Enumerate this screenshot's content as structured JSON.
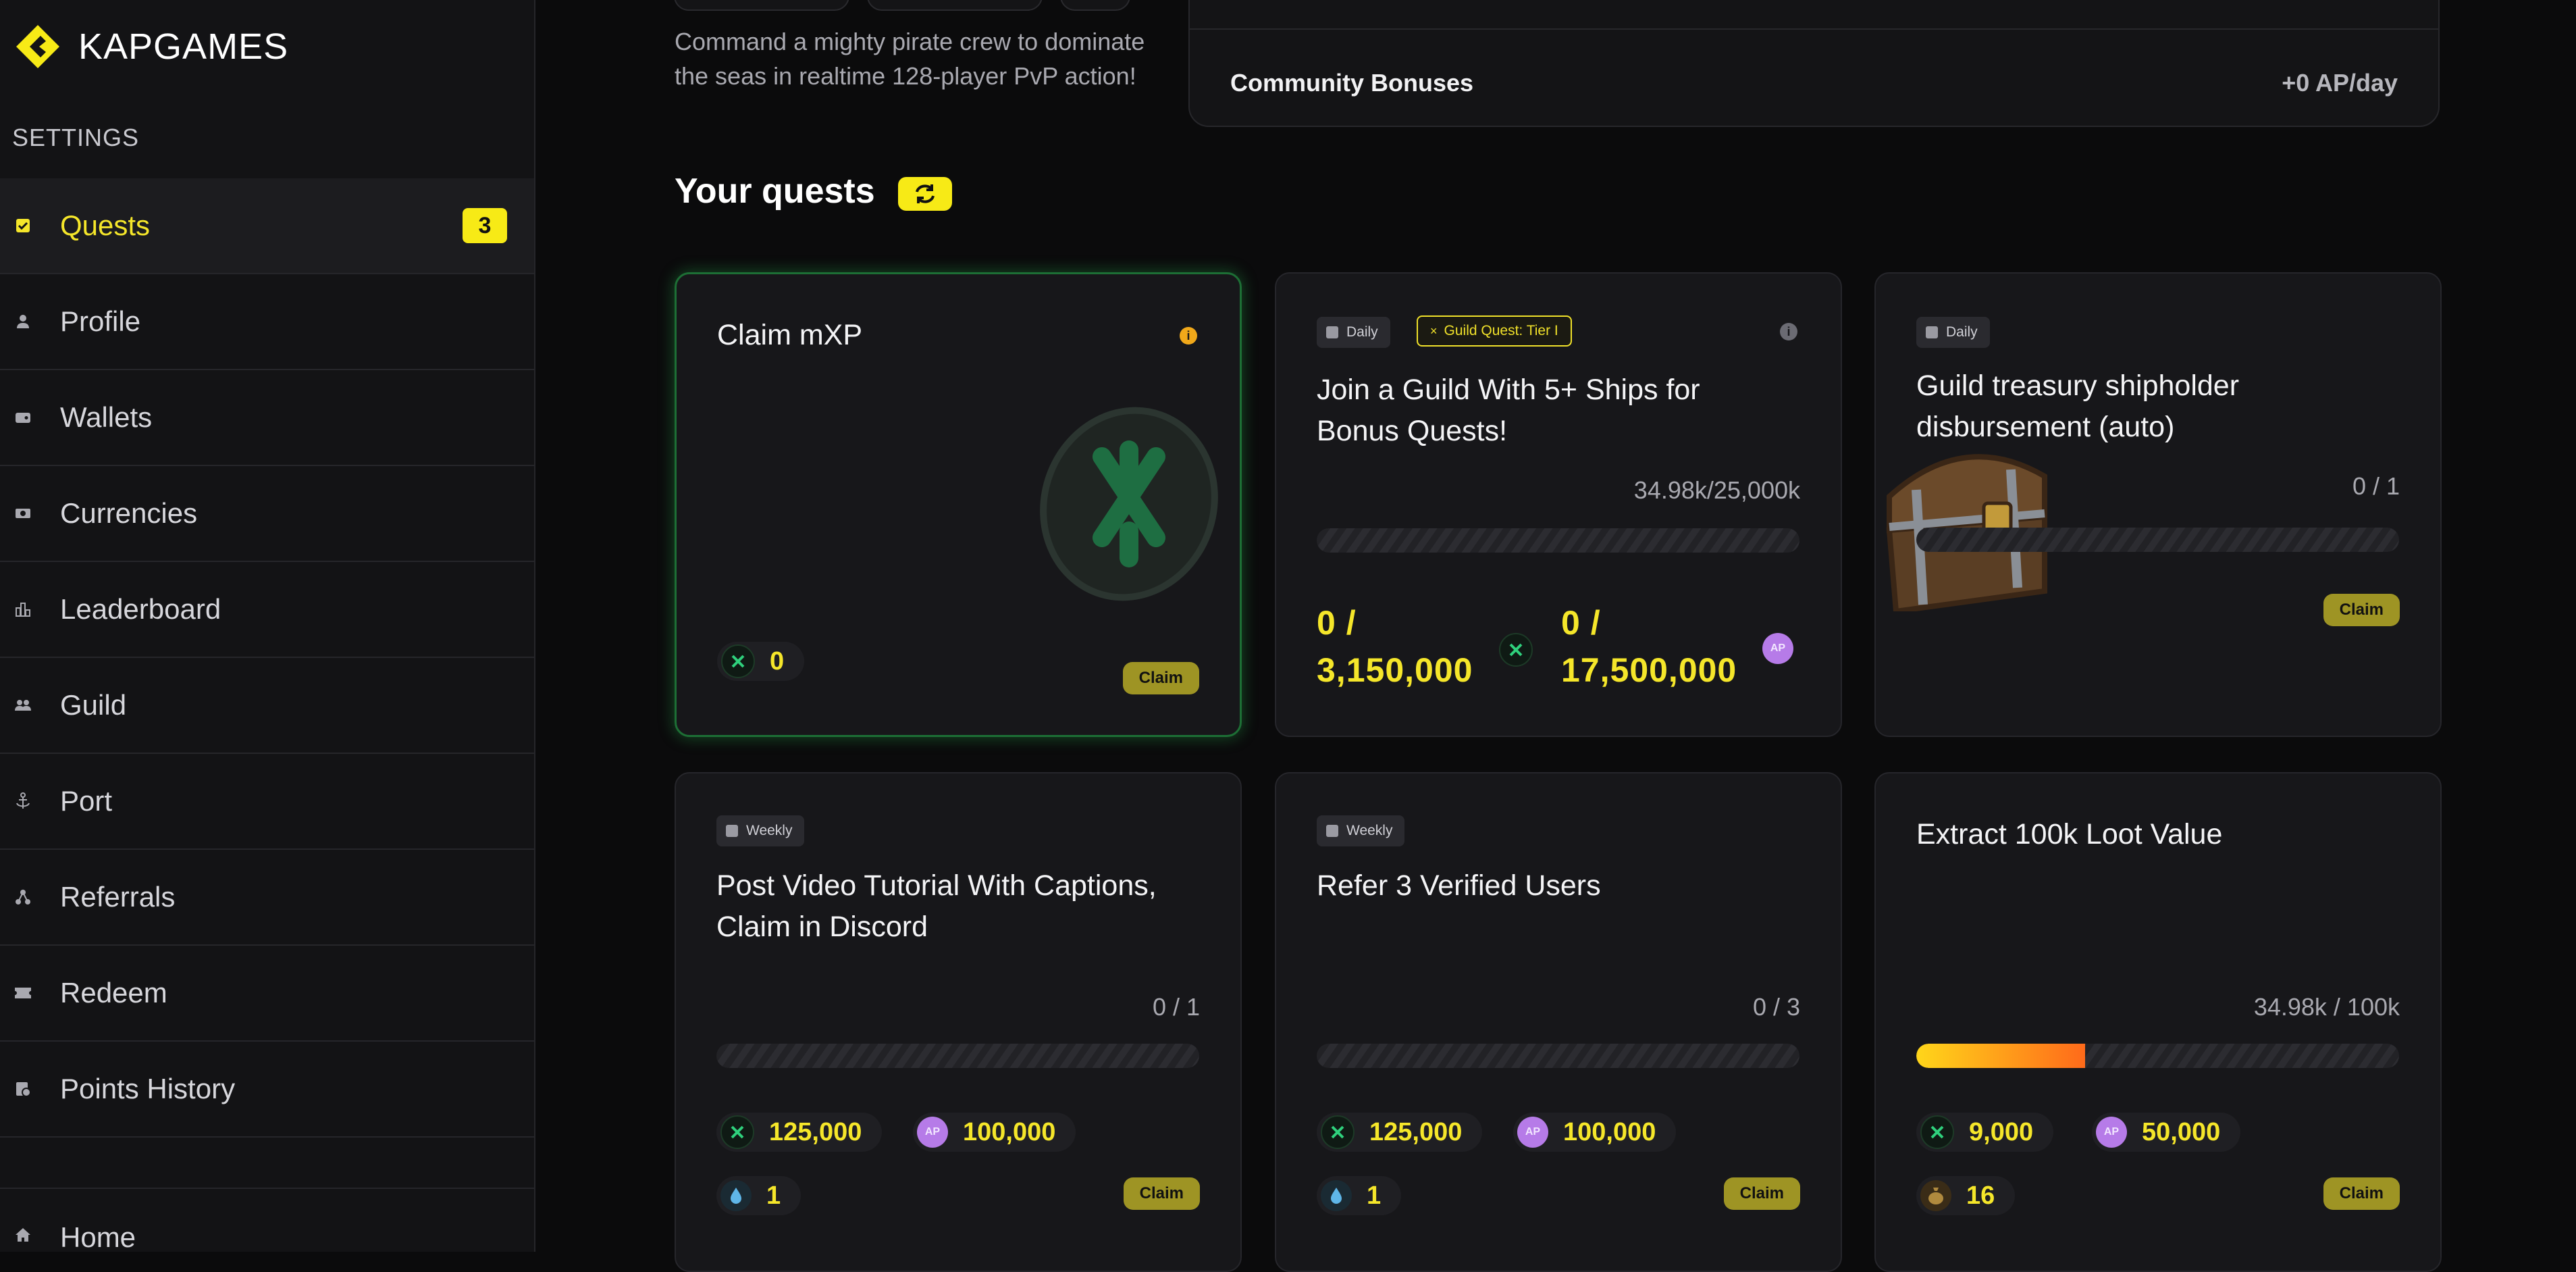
{
  "brand": {
    "name": "KAPGAMES"
  },
  "sidebar": {
    "section_title": "SETTINGS",
    "items": [
      {
        "label": "Quests",
        "icon": "check-square-icon",
        "active": true,
        "badge": "3"
      },
      {
        "label": "Profile",
        "icon": "person-icon"
      },
      {
        "label": "Wallets",
        "icon": "wallet-icon"
      },
      {
        "label": "Currencies",
        "icon": "currency-icon"
      },
      {
        "label": "Leaderboard",
        "icon": "leaderboard-icon"
      },
      {
        "label": "Guild",
        "icon": "group-icon"
      },
      {
        "label": "Port",
        "icon": "anchor-icon"
      },
      {
        "label": "Referrals",
        "icon": "referral-icon"
      },
      {
        "label": "Redeem",
        "icon": "ticket-icon"
      },
      {
        "label": "Points History",
        "icon": "history-icon"
      }
    ],
    "home": {
      "label": "Home",
      "icon": "home-icon"
    }
  },
  "game": {
    "description": "Command a mighty pirate crew to dominate the seas in realtime 128-player PvP action!"
  },
  "bonus": {
    "label": "Community Bonuses",
    "value": "+0 AP/day"
  },
  "quests": {
    "title": "Your quests",
    "cards": [
      {
        "title": "Claim mXP",
        "reward_amount": "0",
        "claim_label": "Claim"
      },
      {
        "tag": "Daily",
        "tag2": "Guild Quest: Tier I",
        "title": "Join a Guild With 5+ Ships for Bonus Quests!",
        "progress": "34.98k/25,000k",
        "amount1_line1": "0 /",
        "amount1_line2": "3,150,000",
        "amount2_line1": "0 /",
        "amount2_line2": "17,500,000"
      },
      {
        "tag": "Daily",
        "title": "Guild treasury shipholder disbursement (auto)",
        "progress": "0 / 1",
        "claim_label": "Claim"
      },
      {
        "tag": "Weekly",
        "title": "Post Video Tutorial With Captions, Claim in Discord",
        "progress": "0 / 1",
        "reward1": "125,000",
        "reward2": "100,000",
        "reward3": "1",
        "claim_label": "Claim"
      },
      {
        "tag": "Weekly",
        "title": "Refer 3 Verified Users",
        "progress": "0 / 3",
        "reward1": "125,000",
        "reward2": "100,000",
        "reward3": "1",
        "claim_label": "Claim"
      },
      {
        "title": "Extract 100k Loot Value",
        "progress": "34.98k / 100k",
        "progress_fraction": 0.35,
        "reward1": "9,000",
        "reward2": "50,000",
        "reward3": "16",
        "claim_label": "Claim"
      }
    ]
  },
  "colors": {
    "accent": "#f7ea16",
    "claim": "#9e9424",
    "glow": "#1d6f35",
    "ap": "#b67be8"
  }
}
